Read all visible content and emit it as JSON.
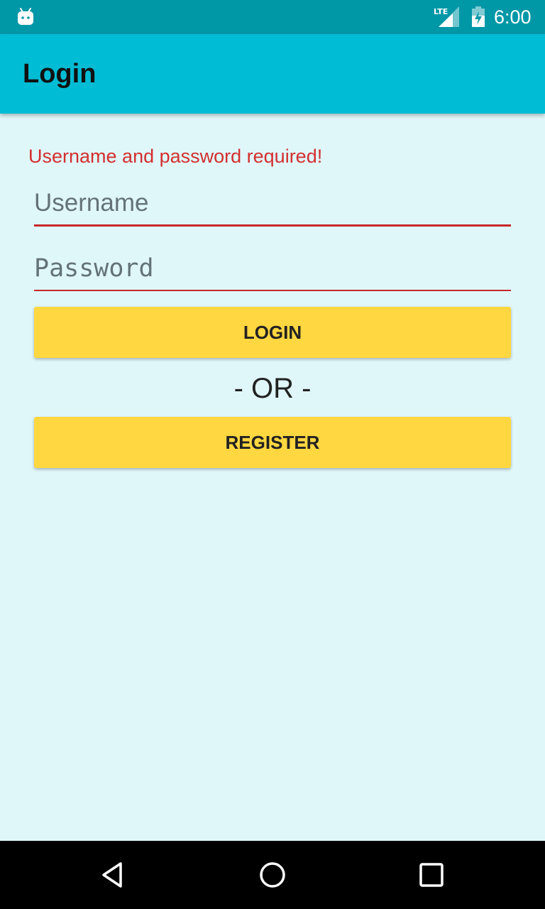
{
  "status_bar": {
    "time": "6:00",
    "icons": [
      "android-notification-icon",
      "lte-signal-icon",
      "battery-icon"
    ]
  },
  "app_bar": {
    "title": "Login"
  },
  "form": {
    "error_message": "Username and password required!",
    "username": {
      "value": "",
      "placeholder": "Username"
    },
    "password": {
      "value": "",
      "placeholder": "Password"
    },
    "login_label": "LOGIN",
    "or_label": "- OR -",
    "register_label": "REGISTER"
  },
  "nav_bar": {
    "icons": [
      "back-icon",
      "home-icon",
      "recents-icon"
    ]
  },
  "colors": {
    "status_bar": "#0097A7",
    "app_bar": "#00BCD4",
    "background": "#E0F7FA",
    "error": "#D32F2F",
    "button": "#FFD740"
  }
}
